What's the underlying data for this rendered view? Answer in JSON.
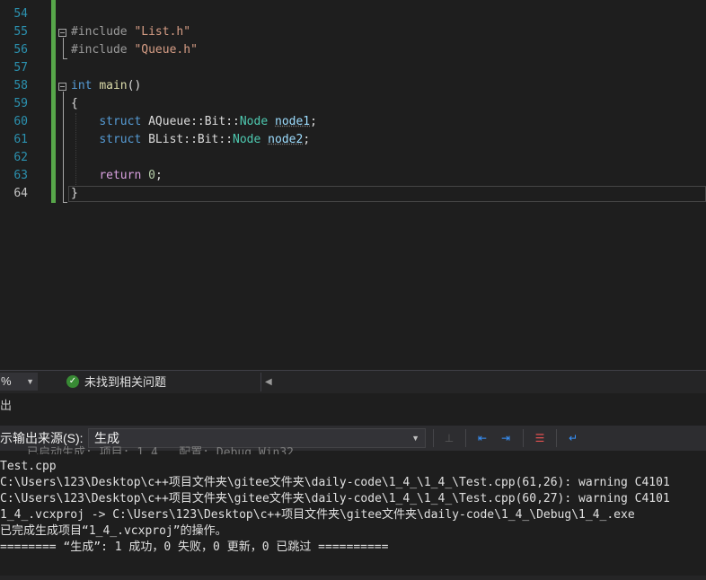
{
  "editor": {
    "line_numbers": [
      "54",
      "55",
      "56",
      "57",
      "58",
      "59",
      "60",
      "61",
      "62",
      "63",
      "64"
    ],
    "lines": [
      [],
      [
        {
          "t": "#include ",
          "c": "pp"
        },
        {
          "t": "\"List.h\"",
          "c": "str"
        }
      ],
      [
        {
          "t": "#include ",
          "c": "pp"
        },
        {
          "t": "\"Queue.h\"",
          "c": "str"
        }
      ],
      [],
      [
        {
          "t": "int",
          "c": "kw"
        },
        {
          "t": " ",
          "c": "plain"
        },
        {
          "t": "main",
          "c": "fn"
        },
        {
          "t": "()",
          "c": "plain"
        }
      ],
      [
        {
          "t": "{",
          "c": "plain"
        }
      ],
      [
        {
          "t": "    ",
          "c": "plain"
        },
        {
          "t": "struct",
          "c": "kw"
        },
        {
          "t": " AQueue::Bit::",
          "c": "plain"
        },
        {
          "t": "Node",
          "c": "ty"
        },
        {
          "t": " ",
          "c": "plain"
        },
        {
          "t": "node1",
          "c": "var"
        },
        {
          "t": ";",
          "c": "plain"
        }
      ],
      [
        {
          "t": "    ",
          "c": "plain"
        },
        {
          "t": "struct",
          "c": "kw"
        },
        {
          "t": " BList::Bit::",
          "c": "plain"
        },
        {
          "t": "Node",
          "c": "ty"
        },
        {
          "t": " ",
          "c": "plain"
        },
        {
          "t": "node2",
          "c": "var"
        },
        {
          "t": ";",
          "c": "plain"
        }
      ],
      [],
      [
        {
          "t": "    ",
          "c": "plain"
        },
        {
          "t": "return",
          "c": "ctl"
        },
        {
          "t": " ",
          "c": "plain"
        },
        {
          "t": "0",
          "c": "num"
        },
        {
          "t": ";",
          "c": "plain"
        }
      ],
      [
        {
          "t": "}",
          "c": "plain"
        }
      ]
    ]
  },
  "status": {
    "zoom": "%",
    "issues_text": "未找到相关问题"
  },
  "output_panel": {
    "title": "出",
    "source_label": "示输出来源(S):",
    "source_value": "生成",
    "obscured_line": "已启动生成: 项目: 1_4_, 配置: Debug Win32",
    "lines": [
      "Test.cpp",
      "C:\\Users\\123\\Desktop\\c++项目文件夹\\gitee文件夹\\daily-code\\1_4_\\1_4_\\Test.cpp(61,26): warning C4101",
      "C:\\Users\\123\\Desktop\\c++项目文件夹\\gitee文件夹\\daily-code\\1_4_\\1_4_\\Test.cpp(60,27): warning C4101",
      "1_4_.vcxproj -> C:\\Users\\123\\Desktop\\c++项目文件夹\\gitee文件夹\\daily-code\\1_4_\\Debug\\1_4_.exe",
      "已完成生成项目“1_4_.vcxproj”的操作。",
      "======== “生成”: 1 成功，0 失败，0 更新，0 已跳过 =========="
    ]
  },
  "icons": {
    "ok": "check-circle-icon",
    "accent": "#57a64a"
  }
}
